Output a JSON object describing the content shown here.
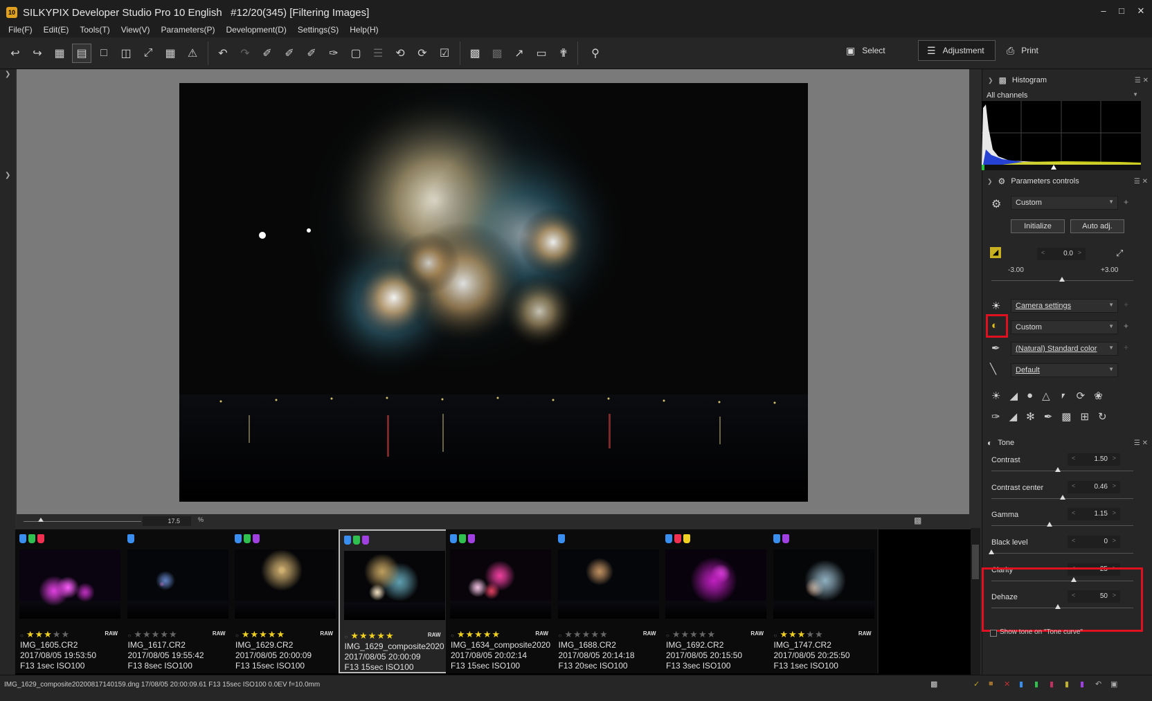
{
  "window": {
    "title": "SILKYPIX Developer Studio Pro 10 English   #12/20(345) [Filtering Images]",
    "app_icon_text": "10"
  },
  "menu": [
    "File(F)",
    "Edit(E)",
    "Tools(T)",
    "View(V)",
    "Parameters(P)",
    "Development(D)",
    "Settings(S)",
    "Help(H)"
  ],
  "modes": {
    "select": "Select",
    "adjustment": "Adjustment",
    "print": "Print"
  },
  "zoom": {
    "value": "17.5",
    "unit": "%"
  },
  "thumbnails": [
    {
      "labels": [
        "#3a8ef0",
        "#30c050",
        "#f03050"
      ],
      "rating": 3,
      "raw": "RAW",
      "name": "IMG_1605.CR2",
      "date": "2017/08/05 19:53:50",
      "exposure": "F13 1sec ISO100",
      "selected": false
    },
    {
      "labels": [
        "#3a8ef0"
      ],
      "rating": 0,
      "raw": "RAW",
      "name": "IMG_1617.CR2",
      "date": "2017/08/05 19:55:42",
      "exposure": "F13 8sec ISO100",
      "selected": false
    },
    {
      "labels": [
        "#3a8ef0",
        "#30c050",
        "#a040e0"
      ],
      "rating": 5,
      "raw": "RAW",
      "name": "IMG_1629.CR2",
      "date": "2017/08/05 20:00:09",
      "exposure": "F13 15sec ISO100",
      "selected": false
    },
    {
      "labels": [
        "#3a8ef0",
        "#30c050",
        "#a040e0"
      ],
      "rating": 5,
      "raw": "RAW",
      "name": "IMG_1629_composite2020",
      "date": "2017/08/05 20:00:09",
      "exposure": "F13 15sec ISO100",
      "selected": true
    },
    {
      "labels": [
        "#3a8ef0",
        "#30c050",
        "#a040e0"
      ],
      "rating": 5,
      "raw": "RAW",
      "name": "IMG_1634_composite2020",
      "date": "2017/08/05 20:02:14",
      "exposure": "F13 15sec ISO100",
      "selected": false
    },
    {
      "labels": [
        "#3a8ef0"
      ],
      "rating": 0,
      "raw": "RAW",
      "name": "IMG_1688.CR2",
      "date": "2017/08/05 20:14:18",
      "exposure": "F13 20sec ISO100",
      "selected": false
    },
    {
      "labels": [
        "#3a8ef0",
        "#f03050",
        "#f0d020"
      ],
      "rating": 0,
      "raw": "RAW",
      "name": "IMG_1692.CR2",
      "date": "2017/08/05 20:15:50",
      "exposure": "F13 3sec ISO100",
      "selected": false
    },
    {
      "labels": [
        "#3a8ef0",
        "#a040e0"
      ],
      "rating": 3,
      "raw": "RAW",
      "name": "IMG_1747.CR2",
      "date": "2017/08/05 20:25:50",
      "exposure": "F13 1sec ISO100",
      "selected": false
    }
  ],
  "status": {
    "text": "IMG_1629_composite20200817140159.dng 17/08/05 20:00:09.61 F13 15sec ISO100  0.0EV f=10.0mm"
  },
  "histogram": {
    "title": "Histogram",
    "channel": "All channels"
  },
  "params": {
    "title": "Parameters controls",
    "preset": "Custom",
    "initialize": "Initialize",
    "auto_adj": "Auto adj.",
    "exposure_value": "0.0",
    "exposure_min": "-3.00",
    "exposure_max": "+3.00",
    "white_balance": "Camera settings",
    "tone": "Custom",
    "color": "(Natural) Standard color",
    "sharpness": "Default"
  },
  "tone": {
    "title": "Tone",
    "sliders": [
      {
        "label": "Contrast",
        "value": "1.50",
        "level": 0.47
      },
      {
        "label": "Contrast center",
        "value": "0.46",
        "level": 0.5
      },
      {
        "label": "Gamma",
        "value": "1.15",
        "level": 0.41
      },
      {
        "label": "Black level",
        "value": "0",
        "level": 0.0
      },
      {
        "label": "Clarity",
        "value": "25",
        "level": 0.58
      },
      {
        "label": "Dehaze",
        "value": "50",
        "level": 0.47
      }
    ],
    "show_curve": "Show tone on \"Tone curve\""
  },
  "colors": {
    "highlight": "#e01020",
    "accent": "#f0d020"
  }
}
